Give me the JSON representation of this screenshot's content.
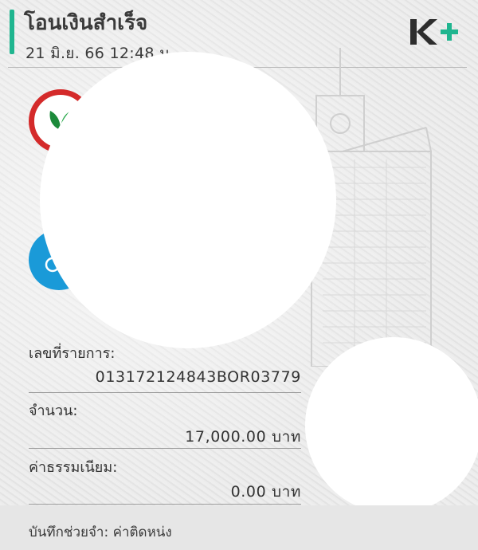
{
  "header": {
    "title": "โอนเงินสำเร็จ",
    "datetime": "21 มิ.ย. 66  12:48 น.",
    "brand": "K+",
    "brand_color": "#1fb58f"
  },
  "logos": {
    "bank_logo_icon": "kasikorn-leaf-icon",
    "bank_logo_color": "#d42a2a",
    "second_logo_icon": "bank-bird-icon",
    "second_logo_color": "#1a9ad8"
  },
  "details": {
    "ref_label": "เลขที่รายการ:",
    "ref_value": "013172124843BOR03779",
    "amount_label": "จำนวน:",
    "amount_value": "17,000.00 บาท",
    "fee_label": "ค่าธรรมเนียม:",
    "fee_value": "0.00 บาท"
  },
  "footer": {
    "memo": "บันทึกช่วยจำ: ค่าติดหน่ง"
  }
}
